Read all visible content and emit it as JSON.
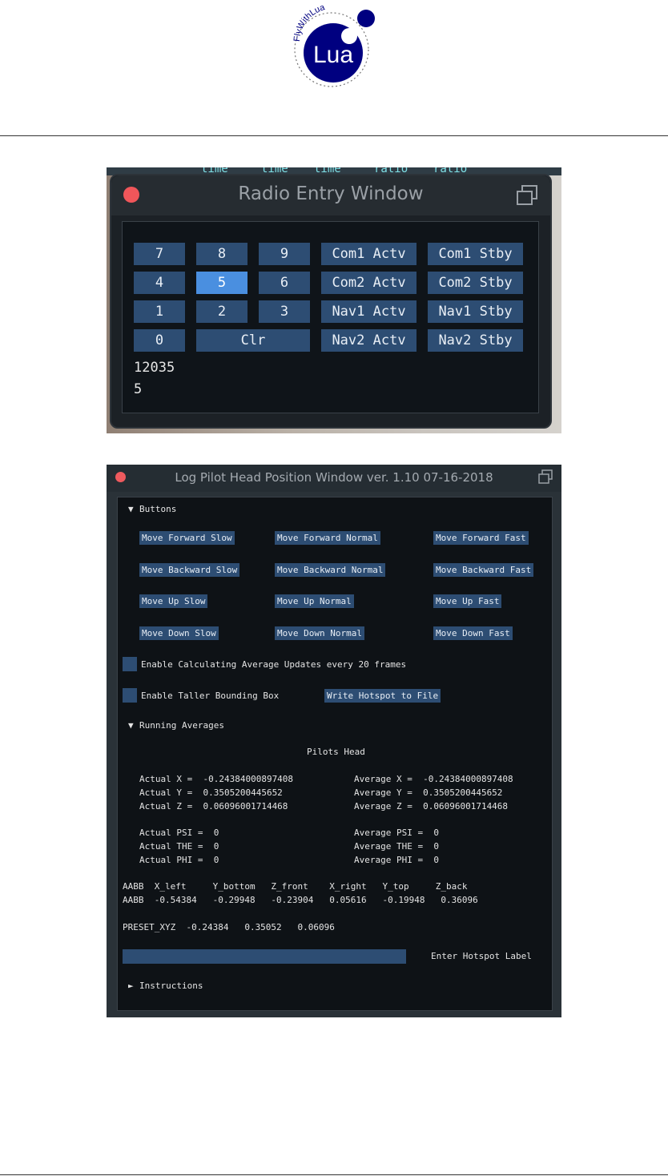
{
  "logo": {
    "text": "Lua",
    "arc_text": "FlyWithLua"
  },
  "strip_words": [
    "time",
    "time",
    "time",
    "ratio",
    "ratio"
  ],
  "radio": {
    "title": "Radio Entry Window",
    "keys": [
      "7",
      "8",
      "9",
      "4",
      "5",
      "6",
      "1",
      "2",
      "3",
      "0",
      "Clr"
    ],
    "active_key": "5",
    "freq_buttons": {
      "com1_actv": "Com1 Actv",
      "com1_stby": "Com1 Stby",
      "com2_actv": "Com2 Actv",
      "com2_stby": "Com2 Stby",
      "nav1_actv": "Nav1 Actv",
      "nav1_stby": "Nav1 Stby",
      "nav2_actv": "Nav2 Actv",
      "nav2_stby": "Nav2 Stby"
    },
    "entry_value": "12035",
    "last_key": "5"
  },
  "log": {
    "title": "Log Pilot Head Position Window ver. 1.10  07-16-2018",
    "buttons_header": "Buttons",
    "move_buttons": {
      "forward_slow": "Move Forward Slow",
      "forward_normal": "Move Forward Normal",
      "forward_fast": "Move Forward Fast",
      "backward_slow": "Move Backward Slow",
      "backward_normal": "Move Backward Normal",
      "backward_fast": "Move Backward Fast",
      "up_slow": "Move Up Slow",
      "up_normal": "Move Up Normal",
      "up_fast": "Move Up Fast",
      "down_slow": "Move Down Slow",
      "down_normal": "Move Down Normal",
      "down_fast": "Move Down Fast"
    },
    "enable_averages_label": "Enable Calculating Average Updates every 20 frames",
    "enable_averages_checked": false,
    "enable_taller_label": "Enable Taller Bounding Box",
    "enable_taller_checked": false,
    "write_hotspot_label": "Write Hotspot to File",
    "running_header": "Running Averages",
    "pilots_head": "Pilots Head",
    "actual": {
      "x": "Actual X =  -0.24384000897408",
      "y": "Actual Y =  0.3505200445652",
      "z": "Actual Z =  0.06096001714468",
      "psi": "Actual PSI =  0",
      "the": "Actual THE =  0",
      "phi": "Actual PHI =  0"
    },
    "average": {
      "x": "Average X =  -0.24384000897408",
      "y": "Average Y =  0.3505200445652",
      "z": "Average Z =  0.06096001714468",
      "psi": "Average PSI =  0",
      "the": "Average THE =  0",
      "phi": "Average PHI =  0"
    },
    "aabb_header": "AABB  X_left     Y_bottom   Z_front    X_right   Y_top     Z_back",
    "aabb_values": "AABB  -0.54384   -0.29948   -0.23904   0.05616   -0.19948   0.36096",
    "preset": "PRESET_XYZ  -0.24384   0.35052   0.06096",
    "hotspot_input_value": "",
    "hotspot_label": "Enter Hotspot Label",
    "instructions_header": "Instructions",
    "expanded_arrow": "▼",
    "collapsed_arrow": "►"
  },
  "colors": {
    "button": "#2d4d73",
    "button_active": "#4a8fe0",
    "close": "#f0565a",
    "panel": "#0e1216"
  }
}
